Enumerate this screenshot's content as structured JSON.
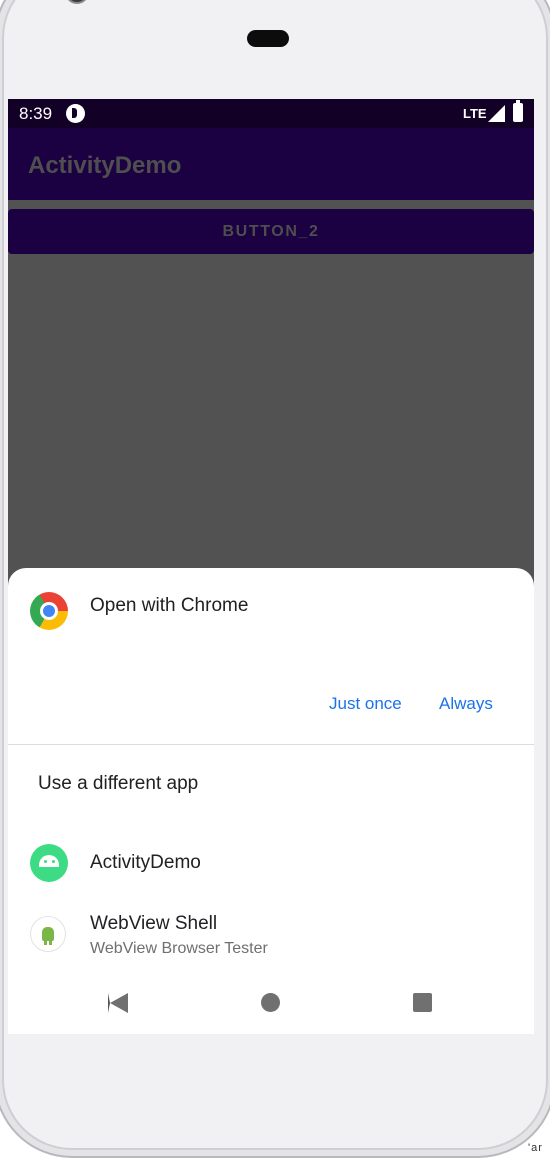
{
  "status_bar": {
    "time": "8:39",
    "network": "LTE",
    "icons": [
      "app-notification-icon",
      "signal-icon",
      "battery-icon"
    ]
  },
  "app_bar": {
    "title": "ActivityDemo"
  },
  "main": {
    "button_label": "BUTTON_2"
  },
  "resolver_sheet": {
    "default_app": {
      "label": "Open with Chrome",
      "icon": "chrome-icon"
    },
    "actions": {
      "just_once": "Just once",
      "always": "Always"
    },
    "different_app_label": "Use a different app",
    "apps": [
      {
        "name": "ActivityDemo",
        "subtitle": "",
        "icon": "android-icon"
      },
      {
        "name": "WebView Shell",
        "subtitle": "WebView Browser Tester",
        "icon": "webview-icon"
      }
    ]
  },
  "nav_bar": {
    "icons": [
      "back-icon",
      "home-icon",
      "recents-icon"
    ]
  },
  "colors": {
    "status_bar": "#120027",
    "app_bar": "#1b0142",
    "dim_overlay": "#525252",
    "accent": "#1a73e8"
  },
  "stray_text": "'ar"
}
